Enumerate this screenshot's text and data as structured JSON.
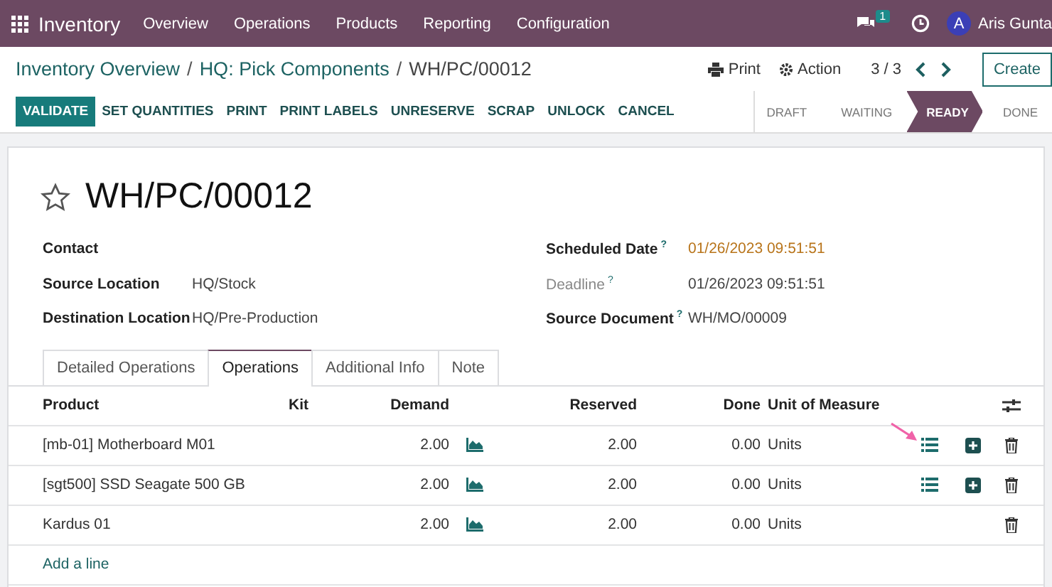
{
  "navbar": {
    "app_name": "Inventory",
    "menu": [
      "Overview",
      "Operations",
      "Products",
      "Reporting",
      "Configuration"
    ],
    "message_count": "1",
    "avatar_initial": "A",
    "user_name": "Aris Gunta"
  },
  "breadcrumb": {
    "separator": "/",
    "items": [
      "Inventory Overview",
      "HQ: Pick Components",
      "WH/PC/00012"
    ]
  },
  "control_panel": {
    "print": "Print",
    "action": "Action",
    "pager": "3 / 3",
    "create": "Create"
  },
  "action_buttons": [
    {
      "label": "VALIDATE",
      "kind": "primary"
    },
    {
      "label": "SET QUANTITIES",
      "kind": "secondary"
    },
    {
      "label": "PRINT",
      "kind": "secondary"
    },
    {
      "label": "PRINT LABELS",
      "kind": "secondary"
    },
    {
      "label": "UNRESERVE",
      "kind": "secondary"
    },
    {
      "label": "SCRAP",
      "kind": "secondary"
    },
    {
      "label": "UNLOCK",
      "kind": "secondary"
    },
    {
      "label": "CANCEL",
      "kind": "secondary"
    }
  ],
  "stages": [
    {
      "label": "DRAFT",
      "selected": false
    },
    {
      "label": "WAITING",
      "selected": false
    },
    {
      "label": "READY",
      "selected": true
    },
    {
      "label": "DONE",
      "selected": false
    }
  ],
  "record": {
    "title": "WH/PC/00012",
    "starred": false
  },
  "left_fields": [
    {
      "label": "Contact"
    },
    {
      "label": "Source Location",
      "value": "HQ/Stock"
    },
    {
      "label": "Destination Location",
      "value": "HQ/Pre-Production"
    }
  ],
  "right_fields": [
    {
      "label": "Scheduled Date",
      "help": "?",
      "value": "01/26/2023 09:51:51",
      "muted": false,
      "warning": true
    },
    {
      "label": "Deadline",
      "help": "?",
      "value": "01/26/2023 09:51:51",
      "muted": true,
      "warning": false
    },
    {
      "label": "Source Document",
      "help": "?",
      "value": "WH/MO/00009",
      "muted": false,
      "warning": false
    }
  ],
  "tabs": [
    {
      "label": "Detailed Operations",
      "selected": false
    },
    {
      "label": "Operations",
      "selected": true
    },
    {
      "label": "Additional Info",
      "selected": false
    },
    {
      "label": "Note",
      "selected": false
    }
  ],
  "table": {
    "columns": [
      "Product",
      "Kit",
      "Demand",
      "Reserved",
      "Done",
      "Unit of Measure"
    ],
    "rows": [
      {
        "product": "[mb-01] Motherboard M01",
        "demand": "2.00",
        "reserved": "2.00",
        "done": "0.00",
        "uom": "Units",
        "has_details": true
      },
      {
        "product": "[sgt500] SSD Seagate 500 GB",
        "demand": "2.00",
        "reserved": "2.00",
        "done": "0.00",
        "uom": "Units",
        "has_details": true
      },
      {
        "product": "Kardus 01",
        "demand": "2.00",
        "reserved": "2.00",
        "done": "0.00",
        "uom": "Units",
        "has_details": false
      }
    ],
    "add_line": "Add a line"
  }
}
